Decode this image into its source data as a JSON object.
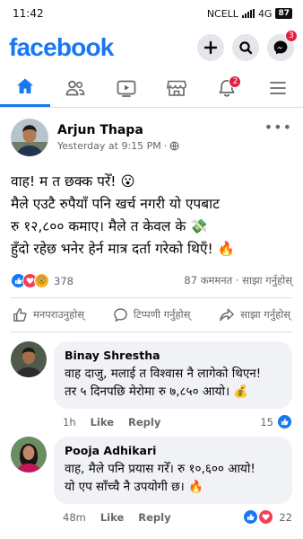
{
  "status_bar": {
    "time": "11:42",
    "carrier": "NCELL",
    "network": "4G",
    "battery": "87"
  },
  "header": {
    "logo": "facebook",
    "messenger_badge": "3"
  },
  "nav": {
    "notifications_badge": "2"
  },
  "post": {
    "author": "Arjun Thapa",
    "timestamp": "Yesterday at 9:15 PM",
    "separator": "·",
    "lines": [
      "वाह! म त छक्क परेँ! 😮",
      "मैले एउटै रुपैयाँ पनि खर्च नगरी यो एपबाट",
      "रु १२,८०० कमाए। मैले त केवल के 💸",
      "हुँदो रहेछ भनेर हेर्न मात्र दर्ता गरेको थिएँ! 🔥"
    ],
    "reaction_count": "378",
    "comments_shares": "87 कममनत · साझा गर्नुहोस्",
    "actions": {
      "like": "मनपराउनुहोस्",
      "comment": "टिप्पणी गर्नुहोस्",
      "share": "साझा गर्नुहोस्"
    }
  },
  "comments": [
    {
      "name": "Binay Shrestha",
      "lines": [
        "वाह दाजु, मलाई त विश्वास नै लागेको थिएन!",
        "तर ५ दिनपछि मेरोमा रु ७,८५० आयो। 💰"
      ],
      "time": "1h",
      "like": "Like",
      "reply": "Reply",
      "reactions": "15"
    },
    {
      "name": "Pooja Adhikari",
      "lines": [
        "वाह, मैले पनि प्रयास गरेँ। रु १०,६०० आयो!",
        "यो एप साँच्चै नै उपयोगी छ। 🔥"
      ],
      "time": "48m",
      "like": "Like",
      "reply": "Reply",
      "reactions": "22"
    }
  ],
  "colors": {
    "brand": "#1877f2",
    "badge": "#e41e3f",
    "muted": "#65676b",
    "bubble": "#f0f2f5"
  },
  "icons": [
    "plus-icon",
    "search-icon",
    "messenger-icon",
    "home-icon",
    "friends-icon",
    "video-icon",
    "marketplace-icon",
    "bell-icon",
    "menu-icon",
    "globe-icon",
    "like-icon",
    "comment-icon",
    "share-icon"
  ]
}
